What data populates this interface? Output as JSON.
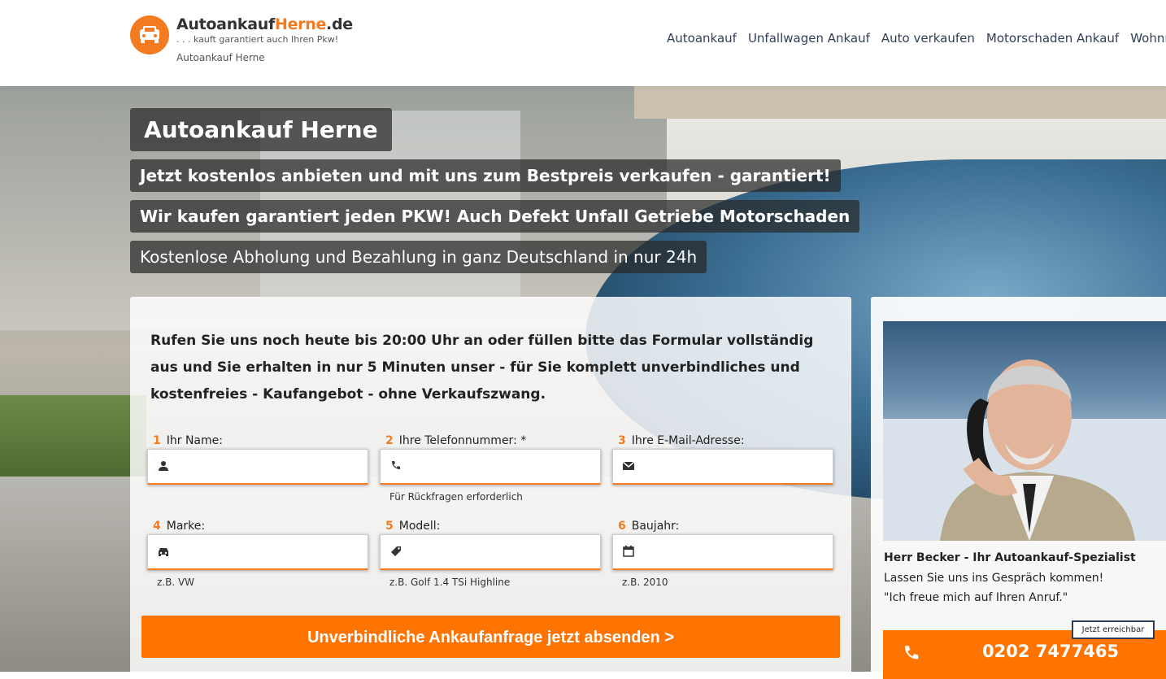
{
  "header": {
    "logo_title_main": "Autoankauf",
    "logo_title_accent": "Herne",
    "logo_title_tld": ".de",
    "logo_tagline": ". . . kauft garantiert auch Ihren Pkw!",
    "logo_subtitle": "Autoankauf Herne",
    "nav": [
      "Autoankauf",
      "Unfallwagen Ankauf",
      "Auto verkaufen",
      "Motorschaden Ankauf",
      "Wohnmob"
    ]
  },
  "hero": {
    "title": "Autoankauf Herne",
    "line1": "Jetzt kostenlos anbieten und mit uns zum Bestpreis verkaufen - garantiert!",
    "line2": "Wir kaufen garantiert jeden PKW! Auch Defekt Unfall Getriebe Motorschaden",
    "line3": "Kostenlose Abholung und Bezahlung in ganz Deutschland in nur 24h"
  },
  "form": {
    "intro": "Rufen Sie uns noch heute bis 20:00 Uhr an oder füllen bitte das Formular vollständig aus und Sie erhalten in nur 5 Minuten unser - für Sie komplett unverbindliches und kostenfreies - Kaufangebot - ohne Verkaufszwang.",
    "fields": [
      {
        "num": "1",
        "label": "Ihr Name:",
        "hint": "",
        "icon": "user-icon"
      },
      {
        "num": "2",
        "label": "Ihre Telefonnummer: *",
        "hint": "Für Rückfragen erforderlich",
        "icon": "phone-icon"
      },
      {
        "num": "3",
        "label": "Ihre E-Mail-Adresse:",
        "hint": "",
        "icon": "envelope-icon"
      },
      {
        "num": "4",
        "label": "Marke:",
        "hint": "z.B. VW",
        "icon": "car-icon"
      },
      {
        "num": "5",
        "label": "Modell:",
        "hint": "z.B. Golf 1.4 TSi Highline",
        "icon": "tag-icon"
      },
      {
        "num": "6",
        "label": "Baujahr:",
        "hint": "z.B. 2010",
        "icon": "calendar-icon"
      }
    ],
    "submit_label": "Unverbindliche Ankaufanfrage jetzt absenden >"
  },
  "contact": {
    "name": "Herr Becker - Ihr Autoankauf-Spezialist",
    "line1": "Lassen Sie uns ins Gespräch kommen!",
    "line2": "\"Ich freue mich auf Ihren Anruf.\"",
    "badge": "Jetzt erreichbar",
    "phone": "0202 7477465"
  },
  "colors": {
    "accent": "#ff7400",
    "logo_orange": "#f47b20",
    "nav_text": "#2f3e57"
  }
}
